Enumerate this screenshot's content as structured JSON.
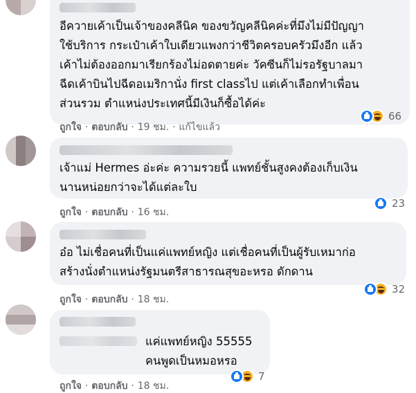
{
  "comments": [
    {
      "text": "อีควายเค้าเป็นเจ้าของคลีนิค ของขวัญคลีนิคค่ะที่มึงไม่มีปัญญา\nใช้บริการ กระเป๋าเค้าใบเดียวแพงกว่าชีวิตครอบครัวมึงอีก แล้ว\nเค้าไม่ต้องออกมาเรียกร้องไม่อดตายค่ะ วัคซีนก็ไม่รอรัฐบาลมา\nฉีดเค้าบินไปฉีดอเมริกานั่ง first classไป แต่เค้าเลือกทำเพื่อน\nส่วนรวม ตำแหน่งประเทศนี้มีเงินก็ซื้อได้ค่ะ",
      "like_label": "ถูกใจ",
      "reply_label": "ตอบกลับ",
      "time": "19 ชม.",
      "edited": "แก้ไขแล้ว",
      "reactions": [
        "like",
        "haha"
      ],
      "reaction_count": "66"
    },
    {
      "text": "เจ้าแม่ Hermes อ่ะค่ะ ความรวยนี้ แพทย์ชั้นสูงคงต้องเก็บเงิน\nนานหน่อยกว่าจะได้แต่ละใบ",
      "like_label": "ถูกใจ",
      "reply_label": "ตอบกลับ",
      "time": "16 ชม.",
      "reactions": [
        "like"
      ],
      "reaction_count": "23"
    },
    {
      "text": "อ๋อ ไม่เชื่อคนที่เป็นแค่แพทย์หญิง แต่เชื่อคนที่เป็นผู้รับเหมาก่อ\nสร้างนั่งตำแหน่งรัฐมนตรีสาธารณสุขอะหรอ ดักดาน",
      "like_label": "ถูกใจ",
      "reply_label": "ตอบกลับ",
      "time": "18 ชม.",
      "reactions": [
        "like",
        "haha"
      ],
      "reaction_count": "32"
    },
    {
      "text": "แค่แพทย์หญิง 55555\nคนพูดเป็นหมอหรอ",
      "like_label": "ถูกใจ",
      "reply_label": "ตอบกลับ",
      "time": "18 ชม.",
      "reactions": [
        "like",
        "haha"
      ],
      "reaction_count": "7"
    }
  ],
  "colors": {
    "bubble": "#f0f2f5",
    "meta_text": "#65676b",
    "like_blue": "#1877f2",
    "haha_yellow": "#f7b125"
  },
  "icons": {
    "like": "like-reaction-icon",
    "haha": "haha-reaction-icon"
  }
}
